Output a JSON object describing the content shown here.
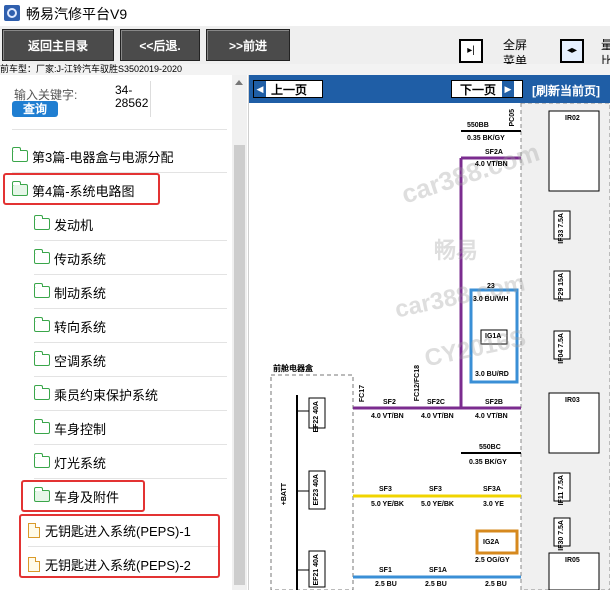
{
  "window": {
    "title": "畅易汽修平台V9"
  },
  "toolbar": {
    "back_main": "返回主目录",
    "back": "<<后退.",
    "forward": ">>前进",
    "fullscreen_line1": "全屏",
    "fullscreen_line2": "菜单",
    "right_line1": "量",
    "right_line2": "比"
  },
  "car_info": "前车型：厂家:J-江铃汽车驭胜S3502019-2020",
  "search": {
    "label": "输入关键字:",
    "code": "34-28562",
    "button": "查询"
  },
  "tree": {
    "items": [
      {
        "label": "第3篇-电器盒与电源分配",
        "icon": "folder-icon"
      },
      {
        "label": "第4篇-系统电路图",
        "icon": "folder-open-icon"
      },
      {
        "label": "发动机",
        "icon": "folder-icon"
      },
      {
        "label": "传动系统",
        "icon": "folder-icon"
      },
      {
        "label": "制动系统",
        "icon": "folder-icon"
      },
      {
        "label": "转向系统",
        "icon": "folder-icon"
      },
      {
        "label": "空调系统",
        "icon": "folder-icon"
      },
      {
        "label": "乘员约束保护系统",
        "icon": "folder-icon"
      },
      {
        "label": "车身控制",
        "icon": "folder-icon"
      },
      {
        "label": "灯光系统",
        "icon": "folder-icon"
      },
      {
        "label": "车身及附件",
        "icon": "folder-open-icon"
      },
      {
        "label": "无钥匙进入系统(PEPS)-1",
        "icon": "document-icon"
      },
      {
        "label": "无钥匙进入系统(PEPS)-2",
        "icon": "document-icon"
      }
    ]
  },
  "diagram_toolbar": {
    "prev": "上一页",
    "next": "下一页",
    "refresh": "[刷新当前页]"
  },
  "watermark": {
    "site": "car388.com",
    "brand": "畅易",
    "code": "CY2016S"
  },
  "diagram": {
    "labels": {
      "batt": "+BATT",
      "front_box": "前舱电器盒",
      "w550bb": "550BB",
      "w035bk": "0.35 BK/GY",
      "sf2a": "SF2A",
      "w40vtbn": "4.0 VT/BN",
      "n23": "23",
      "w30bu": "3.0 BU/WH",
      "ig1a": "IG1A",
      "w30burd": "3.0 BU/RD",
      "sf2": "SF2",
      "sf2c": "SF2C",
      "sf2b": "SF2B",
      "fc17": "FC17",
      "fc12": "FC12/FC18",
      "w40vtbn2": "4.0 VT/BN",
      "w40vtbn3": "4.0 VT/BN",
      "w40vtbn4": "4.0 VT/BN",
      "w550bc": "550BC",
      "w035bk2": "0.35 BK/GY",
      "sf3": "SF3",
      "sf3b": "SF3",
      "sf3a": "SF3A",
      "w50yebk": "5.0 YE/BK",
      "w50yebk2": "5.0 YE/BK",
      "w30ye": "3.0 YE",
      "ig2a": "IG2A",
      "w25oggy": "2.5 OG/GY",
      "sf1": "SF1",
      "sf1a": "SF1A",
      "w25bu": "2.5 BU",
      "w25bu2": "2.5 BU",
      "w25bu3": "2.5 BU",
      "ef23": "EF23 40A",
      "ef22": "EF22 40A",
      "ef21": "EF21 40A",
      "ir02": "IR02",
      "ir03": "IR03",
      "ir05": "IR05",
      "if33": "IF33 7.5A",
      "if29": "IF29 15A",
      "if04": "IF04 7.5A",
      "if11": "IF11 7.5A",
      "if30": "IF30 7.5A",
      "pc05": "PC05"
    }
  },
  "colors": {
    "highlight": "#e33333",
    "toolbar_dark": "#4b4b4b",
    "diagram_bar": "#1f5ea6",
    "wire_purple": "#7b2c8f",
    "wire_yellow": "#f0d400",
    "wire_blue": "#3a8fd6",
    "wire_orange": "#d6891e"
  }
}
